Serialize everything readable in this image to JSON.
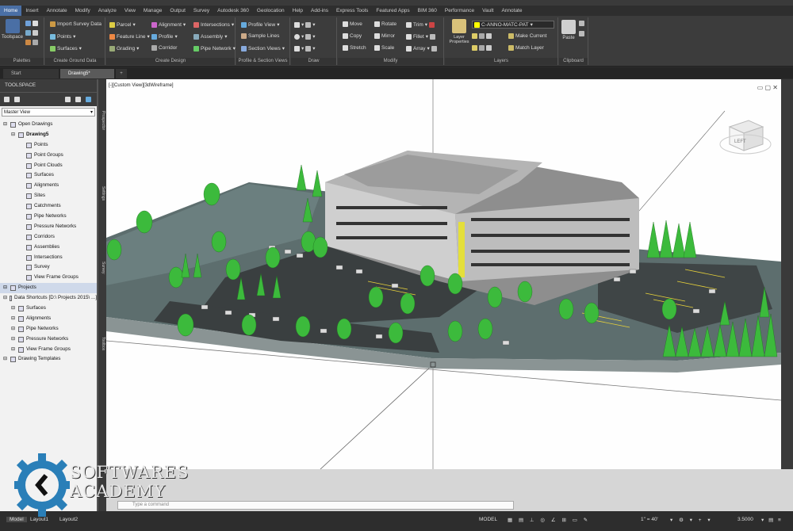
{
  "ribbon_tabs": [
    "Home",
    "Insert",
    "Annotate",
    "Modify",
    "Analyze",
    "View",
    "Manage",
    "Output",
    "Survey",
    "Autodesk 360",
    "Geolocation",
    "Help",
    "Add-ins",
    "Express Tools",
    "Featured Apps",
    "BIM 360",
    "Performance",
    "Vault",
    "Annotate"
  ],
  "ribbon": {
    "palettes": {
      "toolspace": "Toolspace",
      "title": "Palettes"
    },
    "ground": {
      "import": "Import Survey Data",
      "points": "Points",
      "surfaces": "Surfaces",
      "title": "Create Ground Data"
    },
    "design": {
      "parcel": "Parcel",
      "feature_line": "Feature Line",
      "grading": "Grading",
      "alignment": "Alignment",
      "profile": "Profile",
      "corridor": "Corridor",
      "intersections": "Intersections",
      "assembly": "Assembly",
      "pipe_network": "Pipe Network",
      "title": "Create Design"
    },
    "profile_section": {
      "profile_view": "Profile View",
      "sample_lines": "Sample Lines",
      "section_views": "Section Views",
      "title": "Profile & Section Views"
    },
    "draw": {
      "title": "Draw"
    },
    "modify": {
      "move": "Move",
      "rotate": "Rotate",
      "trim": "Trim",
      "copy": "Copy",
      "mirror": "Mirror",
      "fillet": "Fillet",
      "stretch": "Stretch",
      "scale": "Scale",
      "array": "Array",
      "title": "Modify"
    },
    "layers": {
      "layer_properties": "Layer Properties",
      "layer_name": "C-ANNO-MATC-PAT",
      "make_current": "Make Current",
      "match_layer": "Match Layer",
      "title": "Layers"
    },
    "clipboard": {
      "paste": "Paste",
      "title": "Clipboard"
    }
  },
  "doc_tabs": {
    "start": "Start",
    "drawing": "Drawing5*"
  },
  "toolspace": {
    "title": "TOOLSPACE",
    "view_select": "Master View",
    "tree": [
      {
        "label": "Open Drawings",
        "level": 0
      },
      {
        "label": "Drawing5",
        "level": 1,
        "bold": true
      },
      {
        "label": "Points",
        "level": 2
      },
      {
        "label": "Point Groups",
        "level": 2
      },
      {
        "label": "Point Clouds",
        "level": 2
      },
      {
        "label": "Surfaces",
        "level": 2
      },
      {
        "label": "Alignments",
        "level": 2
      },
      {
        "label": "Sites",
        "level": 2
      },
      {
        "label": "Catchments",
        "level": 2
      },
      {
        "label": "Pipe Networks",
        "level": 2
      },
      {
        "label": "Pressure Networks",
        "level": 2
      },
      {
        "label": "Corridors",
        "level": 2
      },
      {
        "label": "Assemblies",
        "level": 2
      },
      {
        "label": "Intersections",
        "level": 2
      },
      {
        "label": "Survey",
        "level": 2
      },
      {
        "label": "View Frame Groups",
        "level": 2
      },
      {
        "label": "Projects",
        "level": 0,
        "selected": true
      },
      {
        "label": "Data Shortcuts [D:\\ Projects 2015\\ ...]",
        "level": 0
      },
      {
        "label": "Surfaces",
        "level": 1
      },
      {
        "label": "Alignments",
        "level": 1
      },
      {
        "label": "Pipe Networks",
        "level": 1
      },
      {
        "label": "Pressure Networks",
        "level": 1
      },
      {
        "label": "View Frame Groups",
        "level": 1
      },
      {
        "label": "Drawing Templates",
        "level": 0
      }
    ],
    "side_tabs": [
      "Prospector",
      "Settings",
      "Survey",
      "Toolbox"
    ]
  },
  "viewport": {
    "label": "[-][Custom View][3dWireframe]",
    "viewcube_label": "LEFT"
  },
  "command": {
    "placeholder": "Type a command"
  },
  "status": {
    "model": "MODEL",
    "scale": "1\" = 40'",
    "zoom": "3.5000"
  },
  "layout_tabs": [
    "Model",
    "Layout1",
    "Layout2"
  ],
  "watermark": {
    "line1": "SOFTWARES",
    "line2": "ACADEMY"
  },
  "colors": {
    "accent": "#4a6fa5",
    "ribbon": "#3c3c3c",
    "building": "#9a9a9a",
    "trees": "#3cba3c",
    "ground": "#5f6e6e"
  }
}
